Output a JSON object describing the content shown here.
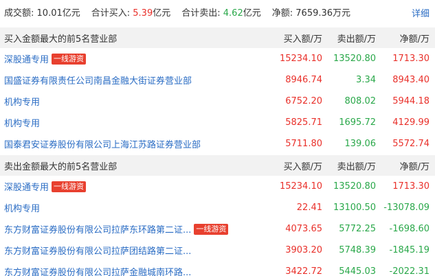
{
  "summary": {
    "turnover_label": "成交额:",
    "turnover_value": "10.01亿元",
    "buy_label": "合计买入:",
    "buy_value": "5.39",
    "sell_label": "合计卖出:",
    "sell_value": "4.62",
    "unit": "亿元",
    "net_label": "净额:",
    "net_value": "7659.36万元",
    "detail_link": "详细"
  },
  "buy_section": {
    "title": "买入金额最大的前5名营业部",
    "col_buy": "买入额/万",
    "col_sell": "卖出额/万",
    "col_net": "净额/万",
    "rows": [
      {
        "name": "深股通专用",
        "tag": "一线游资",
        "buy": "15234.10",
        "sell": "13520.80",
        "net": "1713.30"
      },
      {
        "name": "国盛证券有限责任公司南昌金融大街证券营业部",
        "tag": "",
        "buy": "8946.74",
        "sell": "3.34",
        "net": "8943.40"
      },
      {
        "name": "机构专用",
        "tag": "",
        "buy": "6752.20",
        "sell": "808.02",
        "net": "5944.18"
      },
      {
        "name": "机构专用",
        "tag": "",
        "buy": "5825.71",
        "sell": "1695.72",
        "net": "4129.99"
      },
      {
        "name": "国泰君安证券股份有限公司上海江苏路证券营业部",
        "tag": "",
        "buy": "5711.80",
        "sell": "139.06",
        "net": "5572.74"
      }
    ]
  },
  "sell_section": {
    "title": "卖出金额最大的前5名营业部",
    "col_buy": "买入额/万",
    "col_sell": "卖出额/万",
    "col_net": "净额/万",
    "rows": [
      {
        "name": "深股通专用",
        "tag": "一线游资",
        "buy": "15234.10",
        "sell": "13520.80",
        "net": "1713.30"
      },
      {
        "name": "机构专用",
        "tag": "",
        "buy": "22.41",
        "sell": "13100.50",
        "net": "-13078.09"
      },
      {
        "name": "东方财富证券股份有限公司拉萨东环路第二证...",
        "tag": "一线游资",
        "buy": "4073.65",
        "sell": "5772.25",
        "net": "-1698.60"
      },
      {
        "name": "东方财富证券股份有限公司拉萨团结路第二证...",
        "tag": "",
        "buy": "3903.20",
        "sell": "5748.39",
        "net": "-1845.19"
      },
      {
        "name": "东方财富证券股份有限公司拉萨金融城南环路...",
        "tag": "",
        "buy": "3422.72",
        "sell": "5445.03",
        "net": "-2022.31"
      }
    ]
  },
  "colors": {
    "buy": "#e9302a",
    "sell": "#2aa84a",
    "link": "#2a6cc4",
    "tag_bg": "#e8402f"
  }
}
